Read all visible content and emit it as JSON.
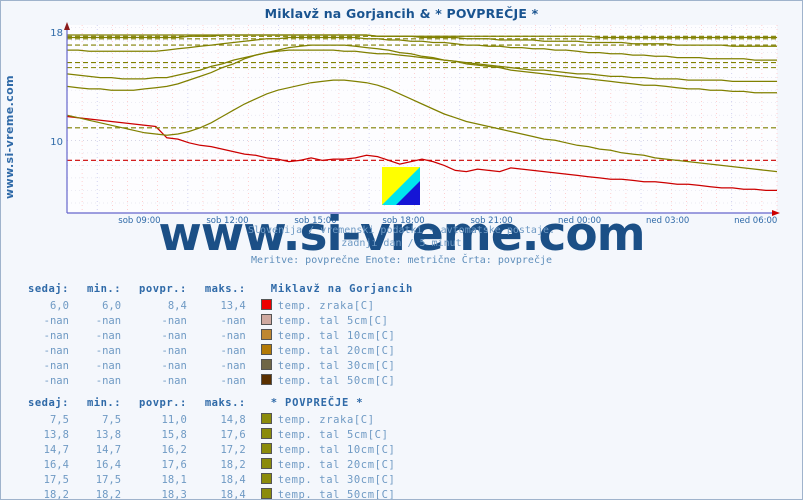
{
  "page": {
    "side_url": "www.si-vreme.com",
    "watermark": "www.si-vreme.com"
  },
  "header": {
    "title": "Miklavž na Gorjancih & * POVPREČJE *"
  },
  "subtitles": {
    "line1": "Slovenija / vremenski podatki - avtomatske postaje.",
    "line2": "zadnji dan / 5 minut",
    "line3": "Meritve: povprečne  Enote: metrične  Črta: povprečje"
  },
  "logo": {
    "name": "si-vreme-logo",
    "colors": [
      "#ffff00",
      "#00e5ee",
      "#1515d6"
    ]
  },
  "colors": {
    "accent_blue": "#1a5490",
    "label_blue": "#2f6aa8",
    "muted_blue": "#6f9ac4",
    "air_red": "#cc0000",
    "olive": "#808000",
    "axis": "#6666cc",
    "grid_red": "#ffb3b3",
    "grid_blue": "#c8c8ee",
    "plot_bg": "#fdfdff"
  },
  "tables": [
    {
      "headers": [
        "sedaj:",
        "min.:",
        "povpr.:",
        "maks.:"
      ],
      "station": "Miklavž na Gorjancih",
      "rows": [
        {
          "sedaj": "6,0",
          "min": "6,0",
          "povpr": "8,4",
          "maks": "13,4",
          "series": "temp. zraka[C]",
          "color": "#ee0000"
        },
        {
          "sedaj": "-nan",
          "min": "-nan",
          "povpr": "-nan",
          "maks": "-nan",
          "series": "temp. tal  5cm[C]",
          "color": "#cfa9a0"
        },
        {
          "sedaj": "-nan",
          "min": "-nan",
          "povpr": "-nan",
          "maks": "-nan",
          "series": "temp. tal 10cm[C]",
          "color": "#bf8730"
        },
        {
          "sedaj": "-nan",
          "min": "-nan",
          "povpr": "-nan",
          "maks": "-nan",
          "series": "temp. tal 20cm[C]",
          "color": "#b37a06"
        },
        {
          "sedaj": "-nan",
          "min": "-nan",
          "povpr": "-nan",
          "maks": "-nan",
          "series": "temp. tal 30cm[C]",
          "color": "#6f6646"
        },
        {
          "sedaj": "-nan",
          "min": "-nan",
          "povpr": "-nan",
          "maks": "-nan",
          "series": "temp. tal 50cm[C]",
          "color": "#5a3000"
        }
      ]
    },
    {
      "headers": [
        "sedaj:",
        "min.:",
        "povpr.:",
        "maks.:"
      ],
      "station": "* POVPREČJE *",
      "rows": [
        {
          "sedaj": "7,5",
          "min": "7,5",
          "povpr": "11,0",
          "maks": "14,8",
          "series": "temp. zraka[C]",
          "color": "#8b8b0b"
        },
        {
          "sedaj": "13,8",
          "min": "13,8",
          "povpr": "15,8",
          "maks": "17,6",
          "series": "temp. tal  5cm[C]",
          "color": "#8b8b0b"
        },
        {
          "sedaj": "14,7",
          "min": "14,7",
          "povpr": "16,2",
          "maks": "17,2",
          "series": "temp. tal 10cm[C]",
          "color": "#8b8b0b"
        },
        {
          "sedaj": "16,4",
          "min": "16,4",
          "povpr": "17,6",
          "maks": "18,2",
          "series": "temp. tal 20cm[C]",
          "color": "#8b8b0b"
        },
        {
          "sedaj": "17,5",
          "min": "17,5",
          "povpr": "18,1",
          "maks": "18,4",
          "series": "temp. tal 30cm[C]",
          "color": "#8b8b0b"
        },
        {
          "sedaj": "18,2",
          "min": "18,2",
          "povpr": "18,3",
          "maks": "18,4",
          "series": "temp. tal 50cm[C]",
          "color": "#8b8b0b"
        }
      ]
    }
  ],
  "chart_data": {
    "type": "line",
    "title": "Miklavž na Gorjancih & * POVPREČJE *",
    "xlabel": "",
    "ylabel": "",
    "ylim": [
      4.2,
      19.2
    ],
    "yticks": [
      10,
      18
    ],
    "ytick_labels": [
      "10",
      "18"
    ],
    "grid": true,
    "legend_position": "below-as-table",
    "x_tick_labels": [
      "sob 09:00",
      "sob 12:00",
      "sob 15:00",
      "sob 18:00",
      "sob 21:00",
      "ned 00:00",
      "ned 03:00",
      "ned 06:00"
    ],
    "x_tick_positions_pct": [
      10.2,
      22.6,
      35.0,
      47.4,
      59.8,
      72.2,
      84.6,
      97.0
    ],
    "x_range_hours": [
      7.3,
      30.8
    ],
    "series": [
      {
        "name": "Miklavž na Gorjancih temp. zraka[C]",
        "color": "#cc0000",
        "style": "solid",
        "values": [
          11.9,
          11.8,
          11.7,
          11.6,
          11.5,
          11.4,
          11.3,
          11.2,
          11.1,
          10.2,
          10.1,
          9.8,
          9.6,
          9.5,
          9.3,
          9.1,
          8.9,
          8.8,
          8.6,
          8.5,
          8.3,
          8.4,
          8.6,
          8.4,
          8.5,
          8.5,
          8.6,
          8.8,
          8.7,
          8.4,
          8.1,
          8.3,
          8.5,
          8.3,
          8.0,
          7.6,
          7.5,
          7.7,
          7.6,
          7.5,
          7.8,
          7.7,
          7.6,
          7.5,
          7.4,
          7.3,
          7.2,
          7.1,
          7.0,
          6.9,
          6.9,
          6.8,
          6.7,
          6.7,
          6.6,
          6.5,
          6.5,
          6.4,
          6.3,
          6.2,
          6.2,
          6.1,
          6.1,
          6.0,
          6.0
        ]
      },
      {
        "name": "Miklavž na Gorjancih povprečje črta",
        "color": "#cc0000",
        "style": "dashed",
        "value": 8.4
      },
      {
        "name": "* POVPREČJE * temp. zraka[C]",
        "color": "#808000",
        "style": "solid",
        "values": [
          12.0,
          11.8,
          11.6,
          11.4,
          11.2,
          11.0,
          10.8,
          10.6,
          10.5,
          10.4,
          10.5,
          10.7,
          11.0,
          11.4,
          11.9,
          12.4,
          12.9,
          13.3,
          13.7,
          14.0,
          14.2,
          14.4,
          14.6,
          14.7,
          14.8,
          14.8,
          14.7,
          14.6,
          14.4,
          14.1,
          13.7,
          13.3,
          12.9,
          12.5,
          12.1,
          11.8,
          11.5,
          11.3,
          11.1,
          10.9,
          10.7,
          10.5,
          10.3,
          10.1,
          10.0,
          9.8,
          9.6,
          9.5,
          9.3,
          9.2,
          9.0,
          8.9,
          8.8,
          8.6,
          8.5,
          8.4,
          8.3,
          8.2,
          8.1,
          8.0,
          7.9,
          7.8,
          7.7,
          7.6,
          7.5
        ]
      },
      {
        "name": "* POVPREČJE * povprečje črta zraka",
        "color": "#808000",
        "style": "dashed",
        "value": 11.0
      },
      {
        "name": "* POVPREČJE * temp. tal 5cm[C]",
        "color": "#808000",
        "style": "solid",
        "values": [
          14.3,
          14.2,
          14.1,
          14.1,
          14.0,
          14.0,
          14.0,
          14.1,
          14.2,
          14.3,
          14.5,
          14.8,
          15.1,
          15.4,
          15.8,
          16.1,
          16.5,
          16.8,
          17.0,
          17.2,
          17.4,
          17.5,
          17.6,
          17.6,
          17.6,
          17.6,
          17.5,
          17.4,
          17.3,
          17.2,
          17.0,
          16.9,
          16.7,
          16.6,
          16.4,
          16.3,
          16.1,
          16.0,
          15.9,
          15.8,
          15.6,
          15.5,
          15.4,
          15.3,
          15.2,
          15.1,
          15.0,
          14.9,
          14.8,
          14.7,
          14.6,
          14.5,
          14.4,
          14.4,
          14.3,
          14.2,
          14.1,
          14.1,
          14.0,
          14.0,
          13.9,
          13.9,
          13.8,
          13.8,
          13.8
        ]
      },
      {
        "name": "* POVPREČJE * povprečje črta 5cm",
        "color": "#808000",
        "style": "dashed",
        "value": 15.8
      },
      {
        "name": "* POVPREČJE * temp. tal 10cm[C]",
        "color": "#808000",
        "style": "solid",
        "values": [
          15.3,
          15.2,
          15.1,
          15.0,
          15.0,
          14.9,
          14.9,
          14.9,
          15.0,
          15.0,
          15.2,
          15.4,
          15.6,
          15.9,
          16.1,
          16.4,
          16.6,
          16.8,
          17.0,
          17.1,
          17.2,
          17.2,
          17.2,
          17.2,
          17.2,
          17.1,
          17.1,
          17.0,
          16.9,
          16.9,
          16.8,
          16.7,
          16.6,
          16.5,
          16.4,
          16.3,
          16.2,
          16.1,
          16.0,
          15.9,
          15.8,
          15.7,
          15.6,
          15.6,
          15.5,
          15.4,
          15.3,
          15.3,
          15.2,
          15.1,
          15.1,
          15.0,
          15.0,
          14.9,
          14.9,
          14.9,
          14.8,
          14.8,
          14.8,
          14.8,
          14.7,
          14.7,
          14.7,
          14.7,
          14.7
        ]
      },
      {
        "name": "* POVPREČJE * povprečje črta 10cm",
        "color": "#808000",
        "style": "dashed",
        "value": 16.2
      },
      {
        "name": "* POVPREČJE * temp. tal 20cm[C]",
        "color": "#808000",
        "style": "solid",
        "values": [
          17.2,
          17.2,
          17.1,
          17.1,
          17.1,
          17.1,
          17.1,
          17.1,
          17.1,
          17.2,
          17.3,
          17.4,
          17.5,
          17.6,
          17.7,
          17.8,
          17.9,
          18.0,
          18.1,
          18.1,
          18.2,
          18.2,
          18.2,
          18.2,
          18.2,
          18.2,
          18.2,
          18.1,
          18.1,
          18.0,
          18.0,
          17.9,
          17.9,
          17.8,
          17.8,
          17.7,
          17.6,
          17.6,
          17.5,
          17.5,
          17.4,
          17.4,
          17.3,
          17.3,
          17.2,
          17.2,
          17.1,
          17.0,
          17.0,
          16.9,
          16.9,
          16.8,
          16.8,
          16.7,
          16.7,
          16.6,
          16.6,
          16.6,
          16.5,
          16.5,
          16.5,
          16.5,
          16.4,
          16.4,
          16.4
        ]
      },
      {
        "name": "* POVPREČJE * povprečje črta 20cm",
        "color": "#808000",
        "style": "dashed",
        "value": 17.6
      },
      {
        "name": "* POVPREČJE * temp. tal 30cm[C]",
        "color": "#808000",
        "style": "solid",
        "values": [
          18.2,
          18.2,
          18.2,
          18.2,
          18.2,
          18.2,
          18.2,
          18.2,
          18.2,
          18.2,
          18.2,
          18.3,
          18.3,
          18.3,
          18.4,
          18.4,
          18.4,
          18.4,
          18.4,
          18.4,
          18.4,
          18.4,
          18.4,
          18.4,
          18.4,
          18.4,
          18.4,
          18.4,
          18.3,
          18.3,
          18.3,
          18.3,
          18.2,
          18.2,
          18.2,
          18.2,
          18.1,
          18.1,
          18.1,
          18.0,
          18.0,
          18.0,
          18.0,
          17.9,
          17.9,
          17.9,
          17.9,
          17.8,
          17.8,
          17.8,
          17.8,
          17.7,
          17.7,
          17.7,
          17.7,
          17.6,
          17.6,
          17.6,
          17.6,
          17.6,
          17.5,
          17.5,
          17.5,
          17.5,
          17.5
        ]
      },
      {
        "name": "* POVPREČJE * povprečje črta 30cm",
        "color": "#808000",
        "style": "dashed",
        "value": 18.1
      },
      {
        "name": "* POVPREČJE * temp. tal 50cm[C]",
        "color": "#808000",
        "style": "solid",
        "values": [
          18.4,
          18.4,
          18.4,
          18.4,
          18.4,
          18.4,
          18.4,
          18.4,
          18.4,
          18.4,
          18.4,
          18.4,
          18.4,
          18.4,
          18.4,
          18.4,
          18.4,
          18.4,
          18.4,
          18.4,
          18.4,
          18.4,
          18.4,
          18.4,
          18.4,
          18.4,
          18.4,
          18.4,
          18.3,
          18.3,
          18.3,
          18.3,
          18.3,
          18.3,
          18.3,
          18.3,
          18.3,
          18.3,
          18.3,
          18.3,
          18.3,
          18.3,
          18.3,
          18.3,
          18.3,
          18.3,
          18.3,
          18.3,
          18.2,
          18.2,
          18.2,
          18.2,
          18.2,
          18.2,
          18.2,
          18.2,
          18.2,
          18.2,
          18.2,
          18.2,
          18.2,
          18.2,
          18.2,
          18.2,
          18.2
        ]
      },
      {
        "name": "* POVPREČJE * povprečje črta 50cm",
        "color": "#808000",
        "style": "dashed",
        "value": 18.3
      }
    ]
  }
}
